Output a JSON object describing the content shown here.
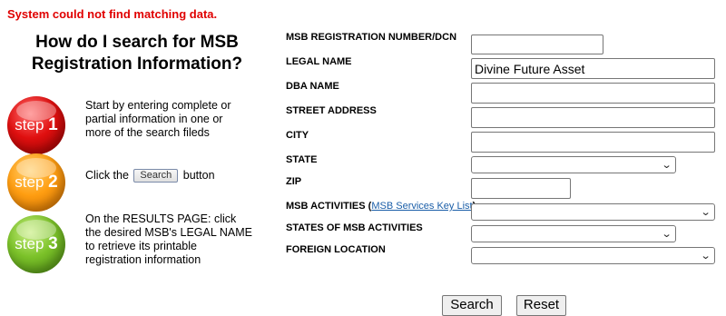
{
  "error_message": "System could not find matching data.",
  "help": {
    "title_line1": "How do I search for MSB",
    "title_line2": "Registration Information?",
    "steps": [
      {
        "word": "step",
        "num": "1",
        "lines": [
          "Start by entering complete or",
          "partial information in one or",
          "more of the search fileds"
        ]
      },
      {
        "word": "step",
        "num": "2",
        "before": "Click the",
        "button": "Search",
        "after": "button"
      },
      {
        "word": "step",
        "num": "3",
        "lines": [
          "On the RESULTS PAGE: click",
          "the desired MSB's LEGAL NAME",
          "to retrieve its printable",
          "registration information"
        ]
      }
    ]
  },
  "form": {
    "msb_number": {
      "label": "MSB REGISTRATION NUMBER/DCN",
      "value": ""
    },
    "legal_name": {
      "label": "LEGAL NAME",
      "value": "Divine Future Asset"
    },
    "dba_name": {
      "label": "DBA NAME",
      "value": ""
    },
    "street": {
      "label": "STREET ADDRESS",
      "value": ""
    },
    "city": {
      "label": "CITY",
      "value": ""
    },
    "state": {
      "label": "STATE",
      "selected": ""
    },
    "zip": {
      "label": "ZIP",
      "value": ""
    },
    "activities": {
      "label": "MSB ACTIVITIES",
      "link": "MSB Services Key List",
      "selected": ""
    },
    "states_of_activities": {
      "label": "STATES OF MSB ACTIVITIES",
      "selected": ""
    },
    "foreign_location": {
      "label": "FOREIGN LOCATION",
      "selected": ""
    }
  },
  "buttons": {
    "search": "Search",
    "reset": "Reset"
  }
}
